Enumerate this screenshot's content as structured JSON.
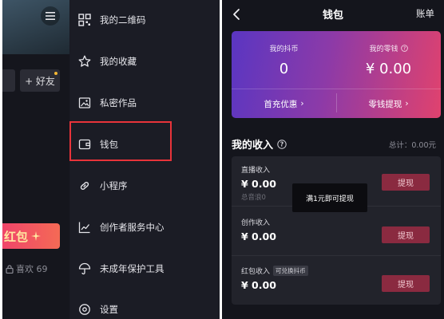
{
  "left": {
    "friend_button": "+ 好友",
    "redpack_text": "红包",
    "likes_text": "喜欢 69",
    "menu_items": [
      {
        "label": "我的二维码",
        "icon": "qrcode-icon"
      },
      {
        "label": "我的收藏",
        "icon": "star-icon"
      },
      {
        "label": "私密作品",
        "icon": "image-icon"
      },
      {
        "label": "钱包",
        "icon": "wallet-icon"
      },
      {
        "label": "小程序",
        "icon": "link-icon"
      },
      {
        "label": "创作者服务中心",
        "icon": "chart-icon"
      },
      {
        "label": "未成年保护工具",
        "icon": "umbrella-icon"
      },
      {
        "label": "设置",
        "icon": "gear-icon"
      }
    ]
  },
  "right": {
    "title": "钱包",
    "bill": "账单",
    "card": {
      "coin_label": "我的抖币",
      "coin_value": "0",
      "change_label": "我的零钱",
      "change_value": "¥ 0.00",
      "first_recharge": "首充优惠",
      "withdraw": "零钱提现",
      "accent_start": "#5a36c2",
      "accent_end": "#e0426e"
    },
    "income": {
      "header": "我的收入",
      "total": "总计：0.00元",
      "rows": [
        {
          "label": "直播收入",
          "value": "¥ 0.00",
          "sub": "总音浪0",
          "button": "提现"
        },
        {
          "label": "创作收入",
          "value": "¥ 0.00",
          "button": "提现"
        },
        {
          "label": "红包收入",
          "tag": "可兑换抖币",
          "value": "¥ 0.00",
          "button": "提现"
        }
      ]
    },
    "toast": "满1元即可提现"
  }
}
